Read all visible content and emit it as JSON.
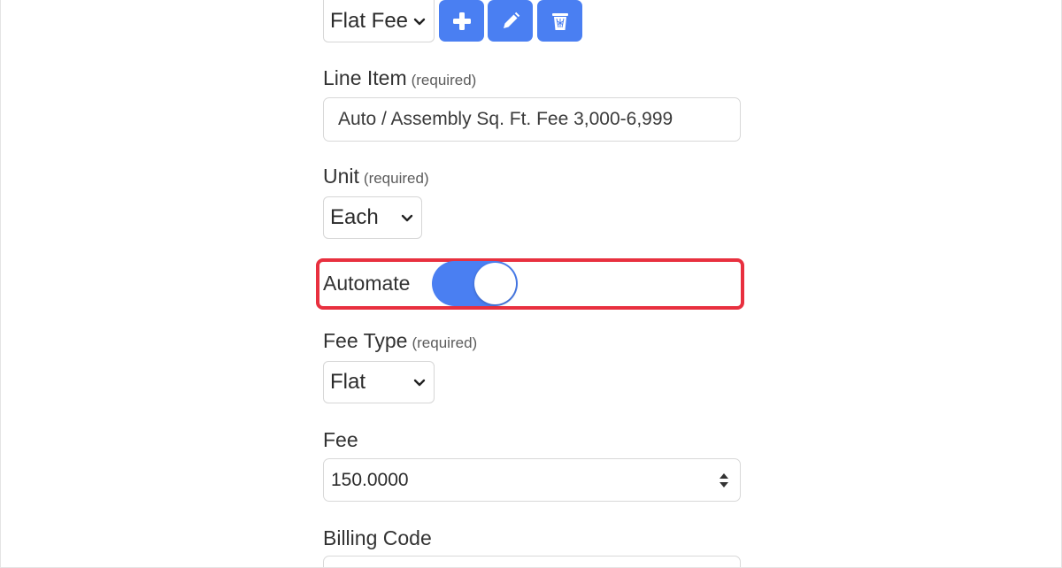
{
  "top": {
    "fee_select_value": "Flat Fee",
    "add_button_icon": "plus-icon",
    "edit_button_icon": "pencil-icon",
    "delete_button_icon": "trash-icon"
  },
  "line_item": {
    "label": "Line Item",
    "required": "(required)",
    "value": "Auto / Assembly Sq. Ft. Fee 3,000-6,999"
  },
  "unit": {
    "label": "Unit",
    "required": "(required)",
    "value": "Each"
  },
  "automate": {
    "label": "Automate",
    "enabled": true
  },
  "fee_type": {
    "label": "Fee Type",
    "required": "(required)",
    "value": "Flat"
  },
  "fee": {
    "label": "Fee",
    "value": "150.0000"
  },
  "billing_code": {
    "label": "Billing Code"
  },
  "colors": {
    "accent": "#4a7ff2",
    "highlight": "#e8303f"
  }
}
